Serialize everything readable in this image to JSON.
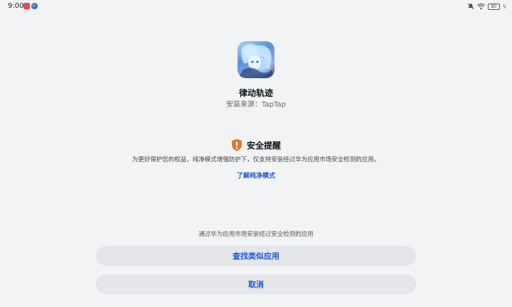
{
  "status_bar": {
    "time": "9:00",
    "battery": "80",
    "icons": [
      "mute-icon",
      "wifi-icon",
      "battery-icon",
      "charging-icon"
    ]
  },
  "app": {
    "name": "律动轨迹",
    "source": "安装来源：TapTap"
  },
  "security": {
    "title": "安全提醒",
    "description": "为更好保护您的权益，纯净模式增强防护下，仅支持安装经过华为应用市场安全检测的应用。",
    "learn_more": "了解纯净模式",
    "accent_color": "#e8772e",
    "link_color": "#1a57d6"
  },
  "actions": {
    "hint": "通过华为应用市场安装经过安全检测的应用",
    "find_similar": "查找类似应用",
    "cancel": "取消"
  }
}
